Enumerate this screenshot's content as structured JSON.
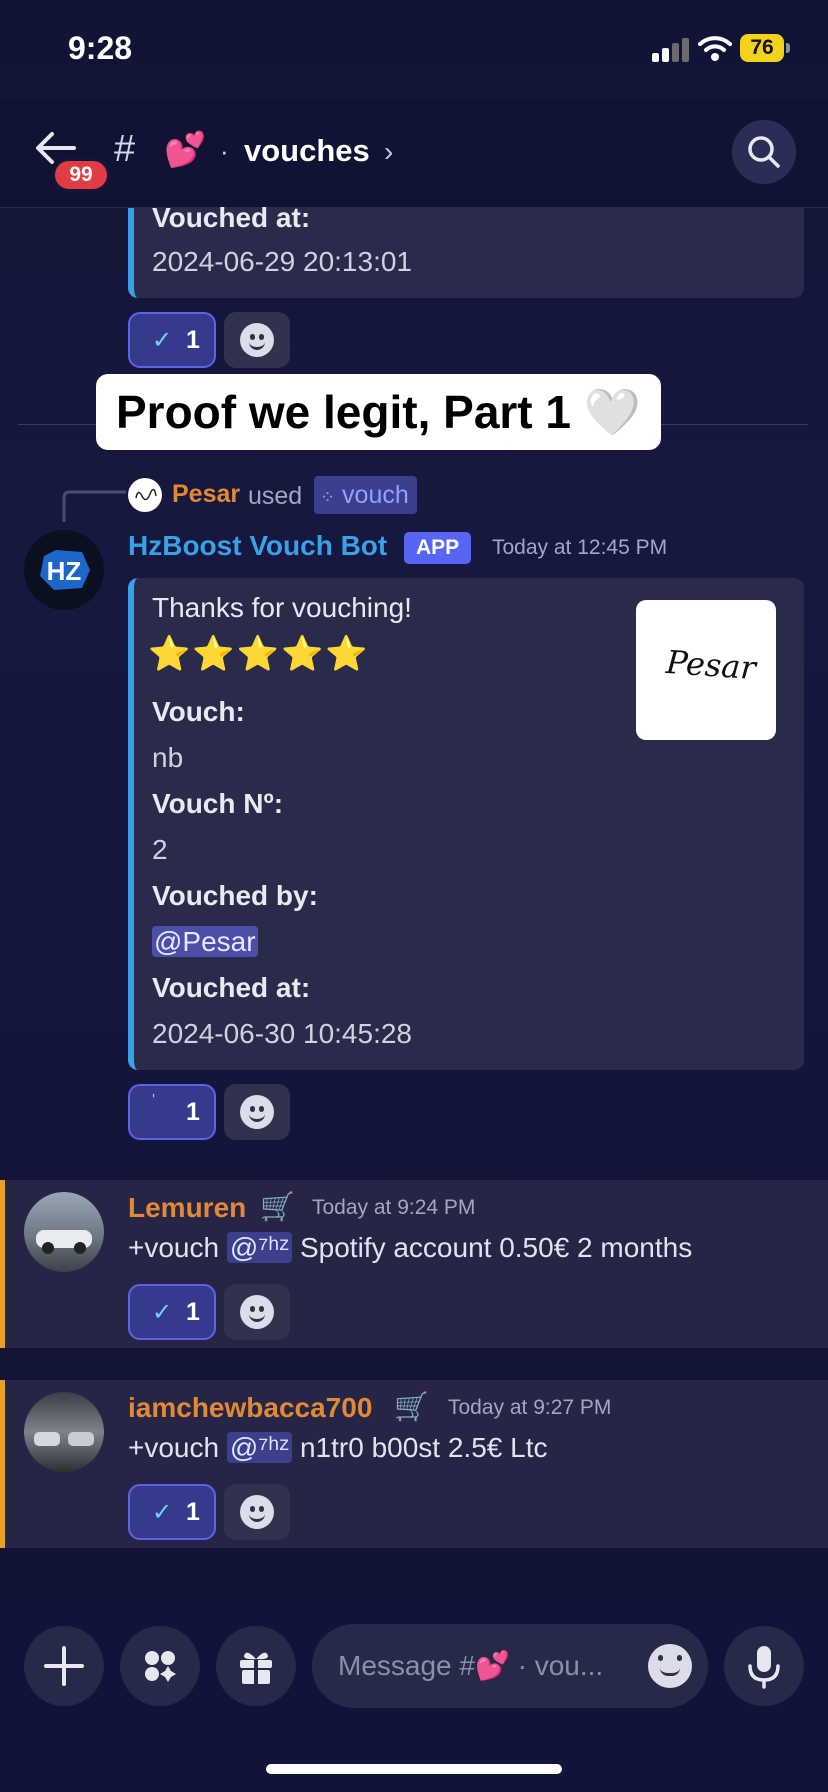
{
  "status_bar": {
    "time": "9:28",
    "battery": "76"
  },
  "header": {
    "unread_count": "99",
    "channel_hash": "#",
    "channel_emoji": "💕",
    "channel_sep": "·",
    "channel_name": "vouches",
    "chevron": "›"
  },
  "top_embed": {
    "field_name": "Vouched at:",
    "field_value": "2024-06-29 20:13:01",
    "reaction_count": "1"
  },
  "caption": "Proof we legit, Part 1 🤍",
  "bot_message": {
    "slash": {
      "user": "Pesar",
      "used_label": "used",
      "command": "vouch"
    },
    "author": "HzBoost Vouch Bot",
    "app_badge": "APP",
    "timestamp": "Today at 12:45 PM",
    "embed": {
      "title": "Thanks for vouching!",
      "stars": "⭐⭐⭐⭐⭐",
      "vouch_label": "Vouch:",
      "vouch_value": "nb",
      "number_label": "Vouch Nº:",
      "number_value": "2",
      "by_label": "Vouched by:",
      "by_value": "@Pesar",
      "at_label": "Vouched at:",
      "at_value": "2024-06-30 10:45:28",
      "thumbnail_text": "Pesar"
    },
    "reaction_count": "1"
  },
  "messages": [
    {
      "author": "Lemuren",
      "badge": "🛒",
      "timestamp": "Today at 9:24 PM",
      "prefix": "+vouch",
      "mention": "@⁷ʰᶻ",
      "text": "Spotify account 0.50€ 2 months",
      "reaction_count": "1"
    },
    {
      "author": "iamchewbacca700",
      "badge": "🛒",
      "timestamp": "Today at 9:27 PM",
      "prefix": "+vouch",
      "mention": "@⁷ʰᶻ",
      "text": "n1tr0 b00st 2.5€ Ltc",
      "reaction_count": "1"
    }
  ],
  "composer": {
    "placeholder": "Message #💕 · vou..."
  },
  "colors": {
    "accent": "#5865f2",
    "embed_bar": "#3aa0e8",
    "bot_name": "#3aa0e8",
    "user_name": "#e08a36",
    "highlight_border": "#e6a421",
    "badge_red": "#e23b44"
  }
}
